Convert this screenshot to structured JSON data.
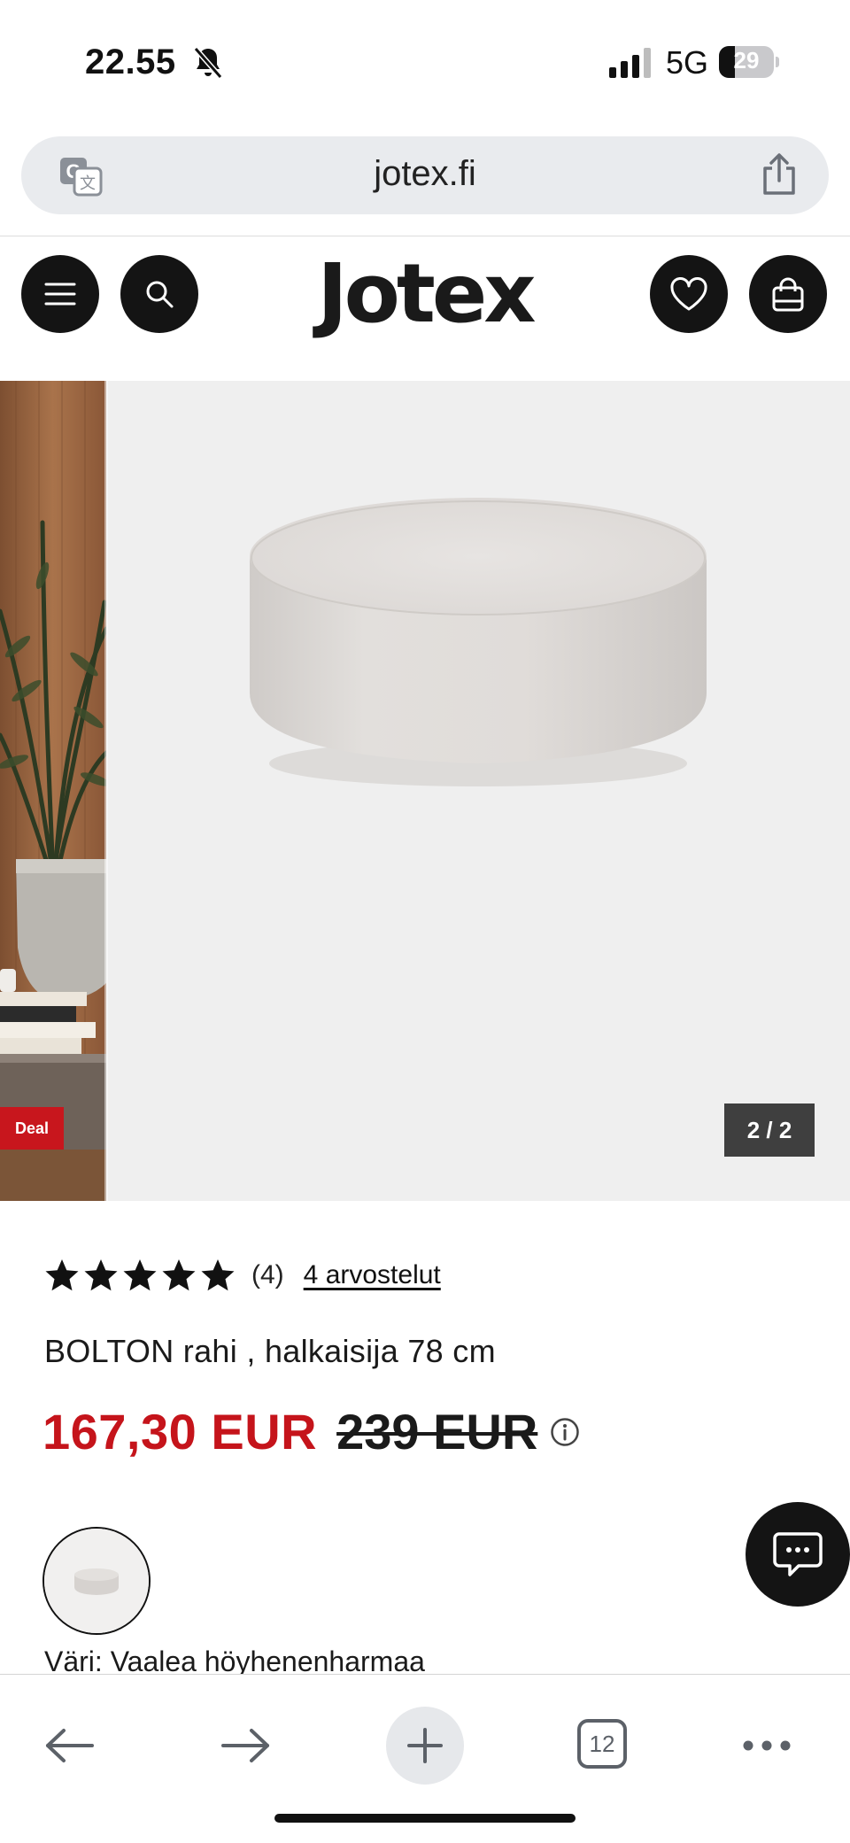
{
  "status_bar": {
    "time": "22.55",
    "network": "5G",
    "battery_percent": "29",
    "battery_level": 0.29
  },
  "browser": {
    "url": "jotex.fi",
    "open_tabs": "12"
  },
  "site": {
    "logo": "Jotex"
  },
  "gallery": {
    "counter": "2 / 2",
    "deal_badge": "Deal"
  },
  "product": {
    "rating_value": 5,
    "rating_count": "(4)",
    "reviews_link": "4 arvostelut",
    "title": "BOLTON rahi , halkaisija 78 cm",
    "sale_price": "167,30 EUR",
    "original_price": "239 EUR",
    "color_label": "Väri: Vaalea höyhenenharmaa"
  },
  "colors": {
    "sale_red": "#c5141b",
    "dark": "#141414",
    "gallery_bg": "#efefef",
    "product_fabric": "#dcd9d6"
  },
  "icons": {
    "header_left": [
      "menu-icon",
      "search-icon"
    ],
    "header_right": [
      "heart-icon",
      "shopping-bag-icon"
    ],
    "toolbar": [
      "back-arrow-icon",
      "forward-arrow-icon",
      "plus-icon",
      "tabs-icon",
      "more-icon"
    ]
  }
}
